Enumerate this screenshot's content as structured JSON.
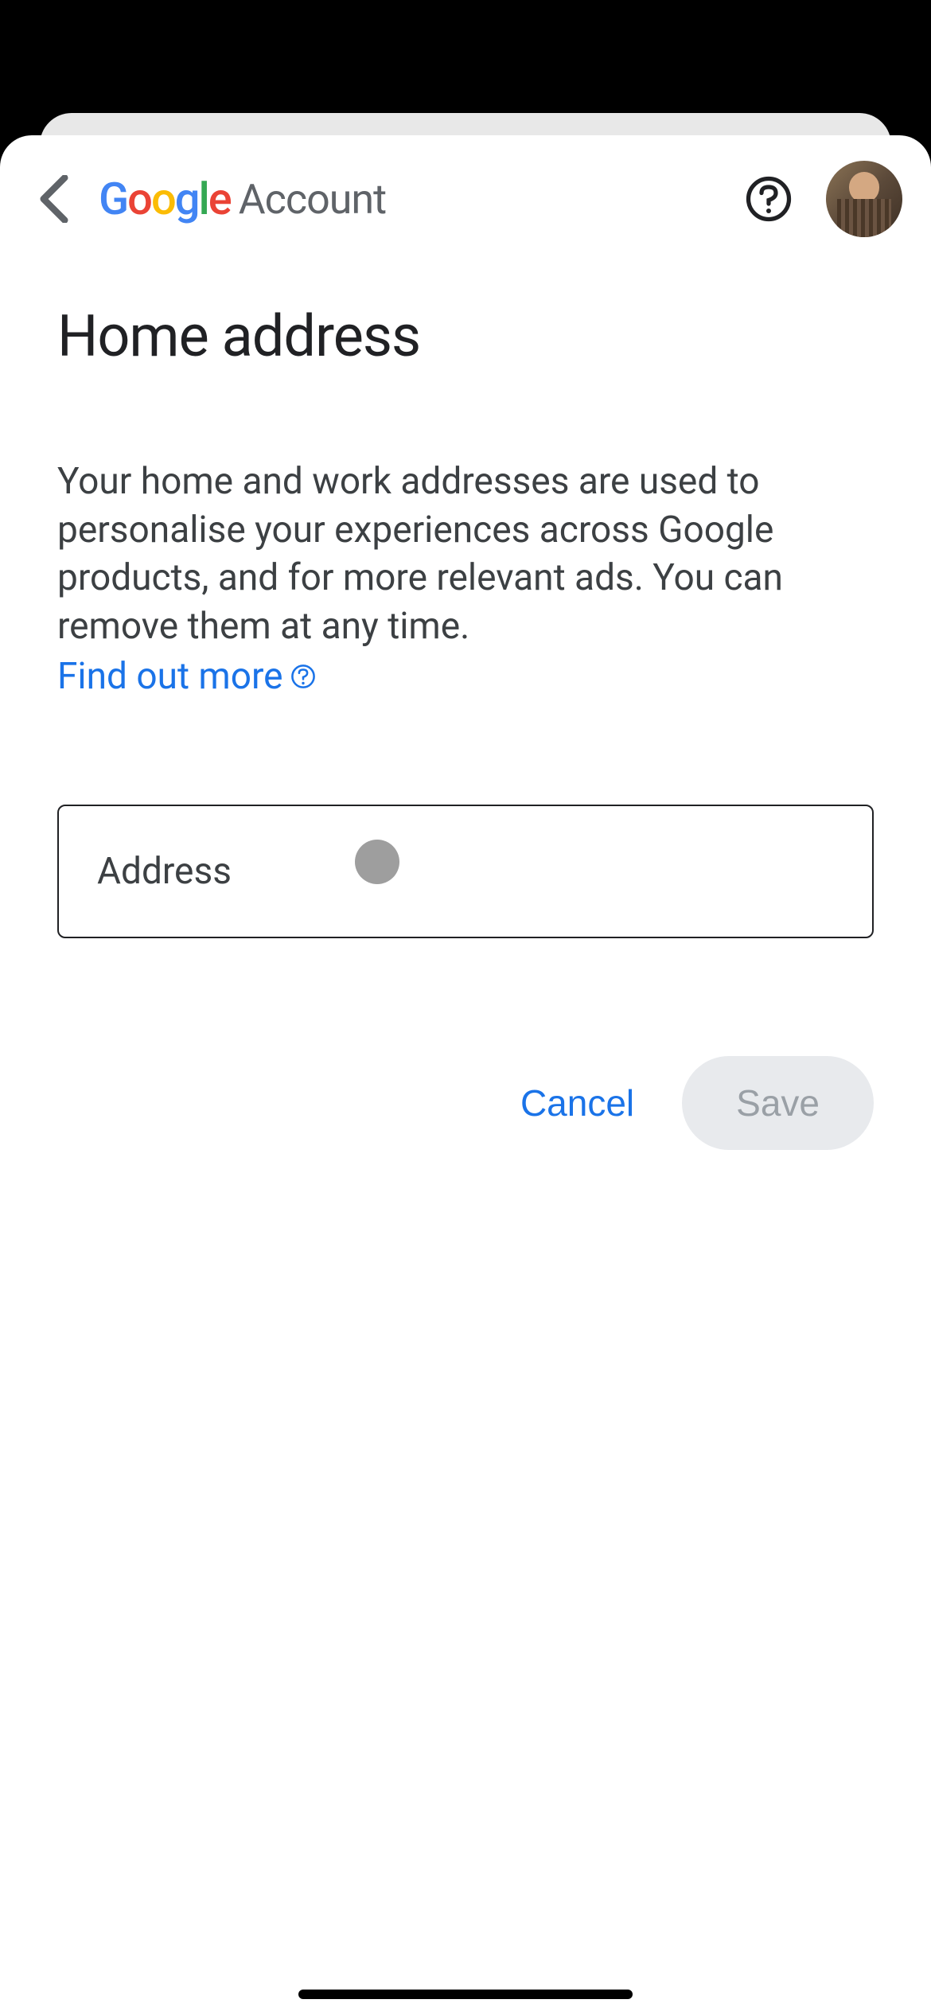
{
  "header": {
    "brand": "Google",
    "account_text": "Account"
  },
  "page": {
    "title": "Home address",
    "description": "Your home and work addresses are used to personalise your experiences across Google products, and for more relevant ads. You can remove them at any time.",
    "learn_more": "Find out more"
  },
  "form": {
    "address_label": "Address",
    "address_value": ""
  },
  "actions": {
    "cancel": "Cancel",
    "save": "Save"
  }
}
